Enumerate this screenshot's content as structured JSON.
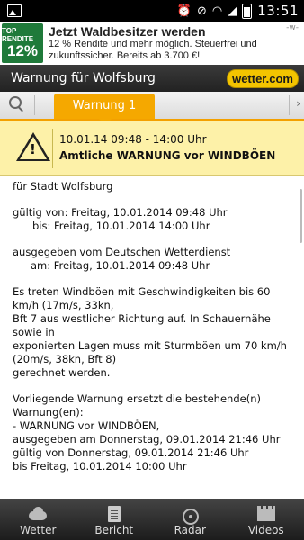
{
  "statusbar": {
    "time": "13:51"
  },
  "ad": {
    "badge_top": "TOP RENDITE",
    "badge_value": "12%",
    "title": "Jetzt Waldbesitzer werden",
    "body": "12 % Rendite und mehr möglich. Steuerfrei und zukunftssicher. Bereits ab 3.700 €!",
    "close": "-w-"
  },
  "header": {
    "title": "Warnung für Wolfsburg",
    "logo": "wetter.com"
  },
  "tabs": {
    "active_label": "Warnung 1"
  },
  "warning": {
    "time": "10.01.14 09:48 - 14:00 Uhr",
    "title": "Amtliche WARNUNG vor WINDBÖEN"
  },
  "content": {
    "for_city": "für Stadt Wolfsburg",
    "valid_from": "gültig von: Freitag, 10.01.2014 09:48 Uhr",
    "valid_to": "bis: Freitag, 10.01.2014 14:00 Uhr",
    "issued_by": "ausgegeben vom Deutschen Wetterdienst",
    "issued_at": "am: Freitag, 10.01.2014 09:48 Uhr",
    "desc1": "Es treten Windböen mit Geschwindigkeiten bis 60 km/h (17m/s, 33kn,",
    "desc2": "Bft 7 aus westlicher Richtung auf. In Schauernähe sowie in",
    "desc3": "exponierten Lagen muss mit Sturmböen um 70 km/h (20m/s, 38kn, Bft 8)",
    "desc4": "gerechnet werden.",
    "replace1": "Vorliegende Warnung ersetzt die bestehende(n) Warnung(en):",
    "replace2": "- WARNUNG vor WINDBÖEN,",
    "replace3": "ausgegeben am Donnerstag, 09.01.2014 21:46 Uhr",
    "replace4": "gültig von Donnerstag, 09.01.2014 21:46 Uhr",
    "replace5": "bis Freitag, 10.01.2014 10:00 Uhr"
  },
  "bottomnav": {
    "items": [
      {
        "label": "Wetter",
        "icon": "cloud-icon"
      },
      {
        "label": "Bericht",
        "icon": "document-icon"
      },
      {
        "label": "Radar",
        "icon": "radar-icon"
      },
      {
        "label": "Videos",
        "icon": "video-icon"
      }
    ]
  },
  "colors": {
    "accent": "#f5a800",
    "warning_bg": "#fdf1a8",
    "header_bg": "#2a2a2a"
  }
}
